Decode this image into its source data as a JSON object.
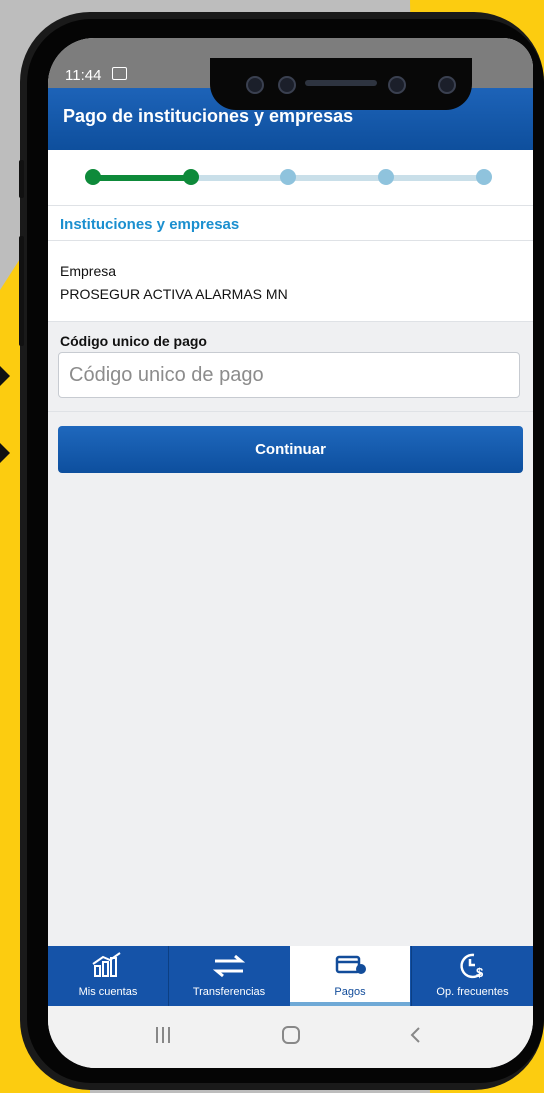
{
  "colors": {
    "primary": "#1553a8",
    "accent": "#1b8fcf",
    "step_done": "#0e8a3a",
    "step_pending": "#8fc3dd"
  },
  "status": {
    "time": "11:44",
    "gallery_icon": "image-icon",
    "right_icons": "signal-wifi-battery-icons"
  },
  "header": {
    "title": "Pago de instituciones y empresas"
  },
  "stepper": {
    "total_steps": 5,
    "current_step": 2
  },
  "section": {
    "title": "Instituciones y empresas"
  },
  "company": {
    "label": "Empresa",
    "value": "PROSEGUR ACTIVA ALARMAS MN"
  },
  "payment_code": {
    "label": "Código unico de pago",
    "placeholder": "Código unico de pago",
    "value": ""
  },
  "actions": {
    "continue_label": "Continuar"
  },
  "tabs": [
    {
      "label": "Mis cuentas",
      "icon": "chart-icon",
      "active": false
    },
    {
      "label": "Transferencias",
      "icon": "transfer-arrows-icon",
      "active": false
    },
    {
      "label": "Pagos",
      "icon": "payment-card-icon",
      "active": true
    },
    {
      "label": "Op. frecuentes",
      "icon": "clock-dollar-icon",
      "active": false
    }
  ],
  "system_nav": {
    "recents": "recents-icon",
    "home": "home-icon",
    "back": "back-icon"
  }
}
